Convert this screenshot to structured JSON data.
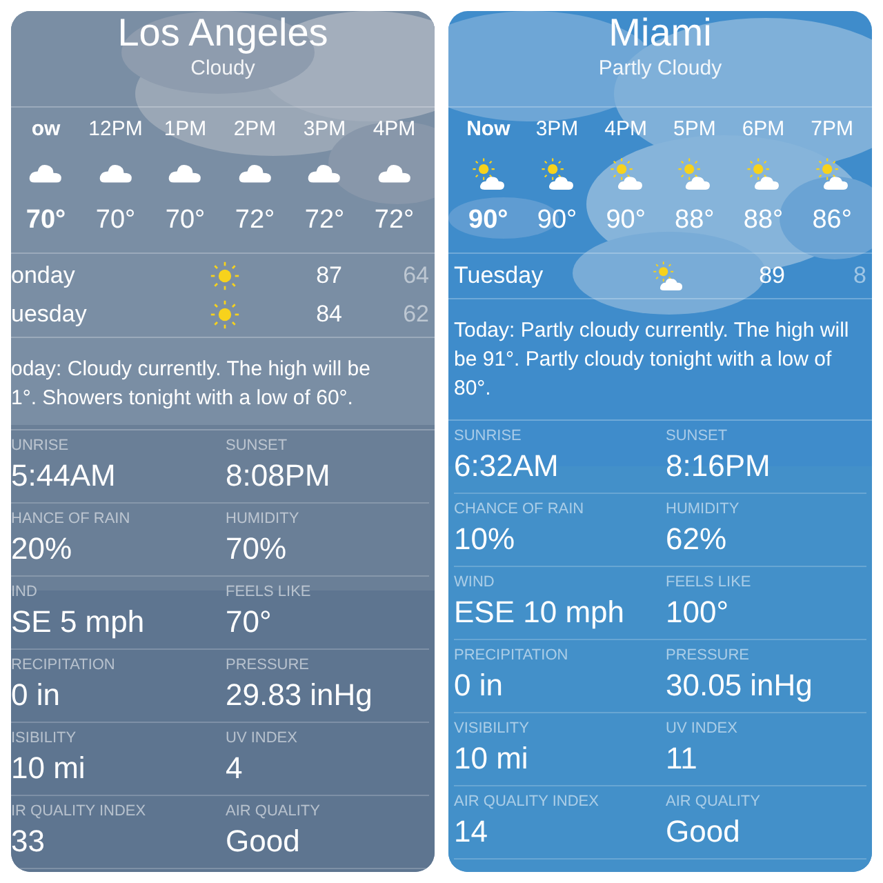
{
  "panels": [
    {
      "city": "Los Angeles",
      "condition": "Cloudy",
      "hours": [
        {
          "time": "ow",
          "kind": "cloudy",
          "temp": "70°",
          "current": true
        },
        {
          "time": "12PM",
          "kind": "cloudy",
          "temp": "70°",
          "current": false
        },
        {
          "time": "1PM",
          "kind": "cloudy",
          "temp": "70°",
          "current": false
        },
        {
          "time": "2PM",
          "kind": "cloudy",
          "temp": "72°",
          "current": false
        },
        {
          "time": "3PM",
          "kind": "cloudy",
          "temp": "72°",
          "current": false
        },
        {
          "time": "4PM",
          "kind": "cloudy",
          "temp": "72°",
          "current": false
        }
      ],
      "days": [
        {
          "day": "onday",
          "kind": "sunny",
          "high": "87",
          "low": "64"
        },
        {
          "day": "uesday",
          "kind": "sunny",
          "high": "84",
          "low": "62"
        }
      ],
      "summary": "oday: Cloudy currently. The high will be\n1°. Showers tonight with a low of 60°.",
      "details": [
        {
          "label": "UNRISE",
          "value": "5:44AM"
        },
        {
          "label": "SUNSET",
          "value": "8:08PM"
        },
        {
          "label": "HANCE OF RAIN",
          "value": "20%"
        },
        {
          "label": "HUMIDITY",
          "value": "70%"
        },
        {
          "label": "IND",
          "value": "SE 5 mph"
        },
        {
          "label": "FEELS LIKE",
          "value": "70°"
        },
        {
          "label": "RECIPITATION",
          "value": "0 in"
        },
        {
          "label": "PRESSURE",
          "value": "29.83 inHg"
        },
        {
          "label": "ISIBILITY",
          "value": "10 mi"
        },
        {
          "label": "UV INDEX",
          "value": "4"
        },
        {
          "label": "IR QUALITY INDEX",
          "value": "33"
        },
        {
          "label": "AIR QUALITY",
          "value": "Good"
        }
      ]
    },
    {
      "city": "Miami",
      "condition": "Partly Cloudy",
      "hours": [
        {
          "time": "Now",
          "kind": "partly_cloudy",
          "temp": "90°",
          "current": true
        },
        {
          "time": "3PM",
          "kind": "partly_cloudy",
          "temp": "90°",
          "current": false
        },
        {
          "time": "4PM",
          "kind": "partly_cloudy",
          "temp": "90°",
          "current": false
        },
        {
          "time": "5PM",
          "kind": "partly_cloudy",
          "temp": "88°",
          "current": false
        },
        {
          "time": "6PM",
          "kind": "partly_cloudy",
          "temp": "88°",
          "current": false
        },
        {
          "time": "7PM",
          "kind": "partly_cloudy",
          "temp": "86°",
          "current": false
        }
      ],
      "days": [
        {
          "day": "Tuesday",
          "kind": "partly_cloudy",
          "high": "89",
          "low": "8"
        }
      ],
      "summary": "Today: Partly cloudy currently. The high will\nbe 91°. Partly cloudy tonight with a low of\n80°.",
      "details": [
        {
          "label": "SUNRISE",
          "value": "6:32AM"
        },
        {
          "label": "SUNSET",
          "value": "8:16PM"
        },
        {
          "label": "CHANCE OF RAIN",
          "value": "10%"
        },
        {
          "label": "HUMIDITY",
          "value": "62%"
        },
        {
          "label": "WIND",
          "value": "ESE 10 mph"
        },
        {
          "label": "FEELS LIKE",
          "value": "100°"
        },
        {
          "label": "PRECIPITATION",
          "value": "0 in"
        },
        {
          "label": "PRESSURE",
          "value": "30.05 inHg"
        },
        {
          "label": "VISIBILITY",
          "value": "10 mi"
        },
        {
          "label": "UV INDEX",
          "value": "11"
        },
        {
          "label": "AIR QUALITY INDEX",
          "value": "14"
        },
        {
          "label": "AIR QUALITY",
          "value": "Good"
        }
      ]
    }
  ]
}
